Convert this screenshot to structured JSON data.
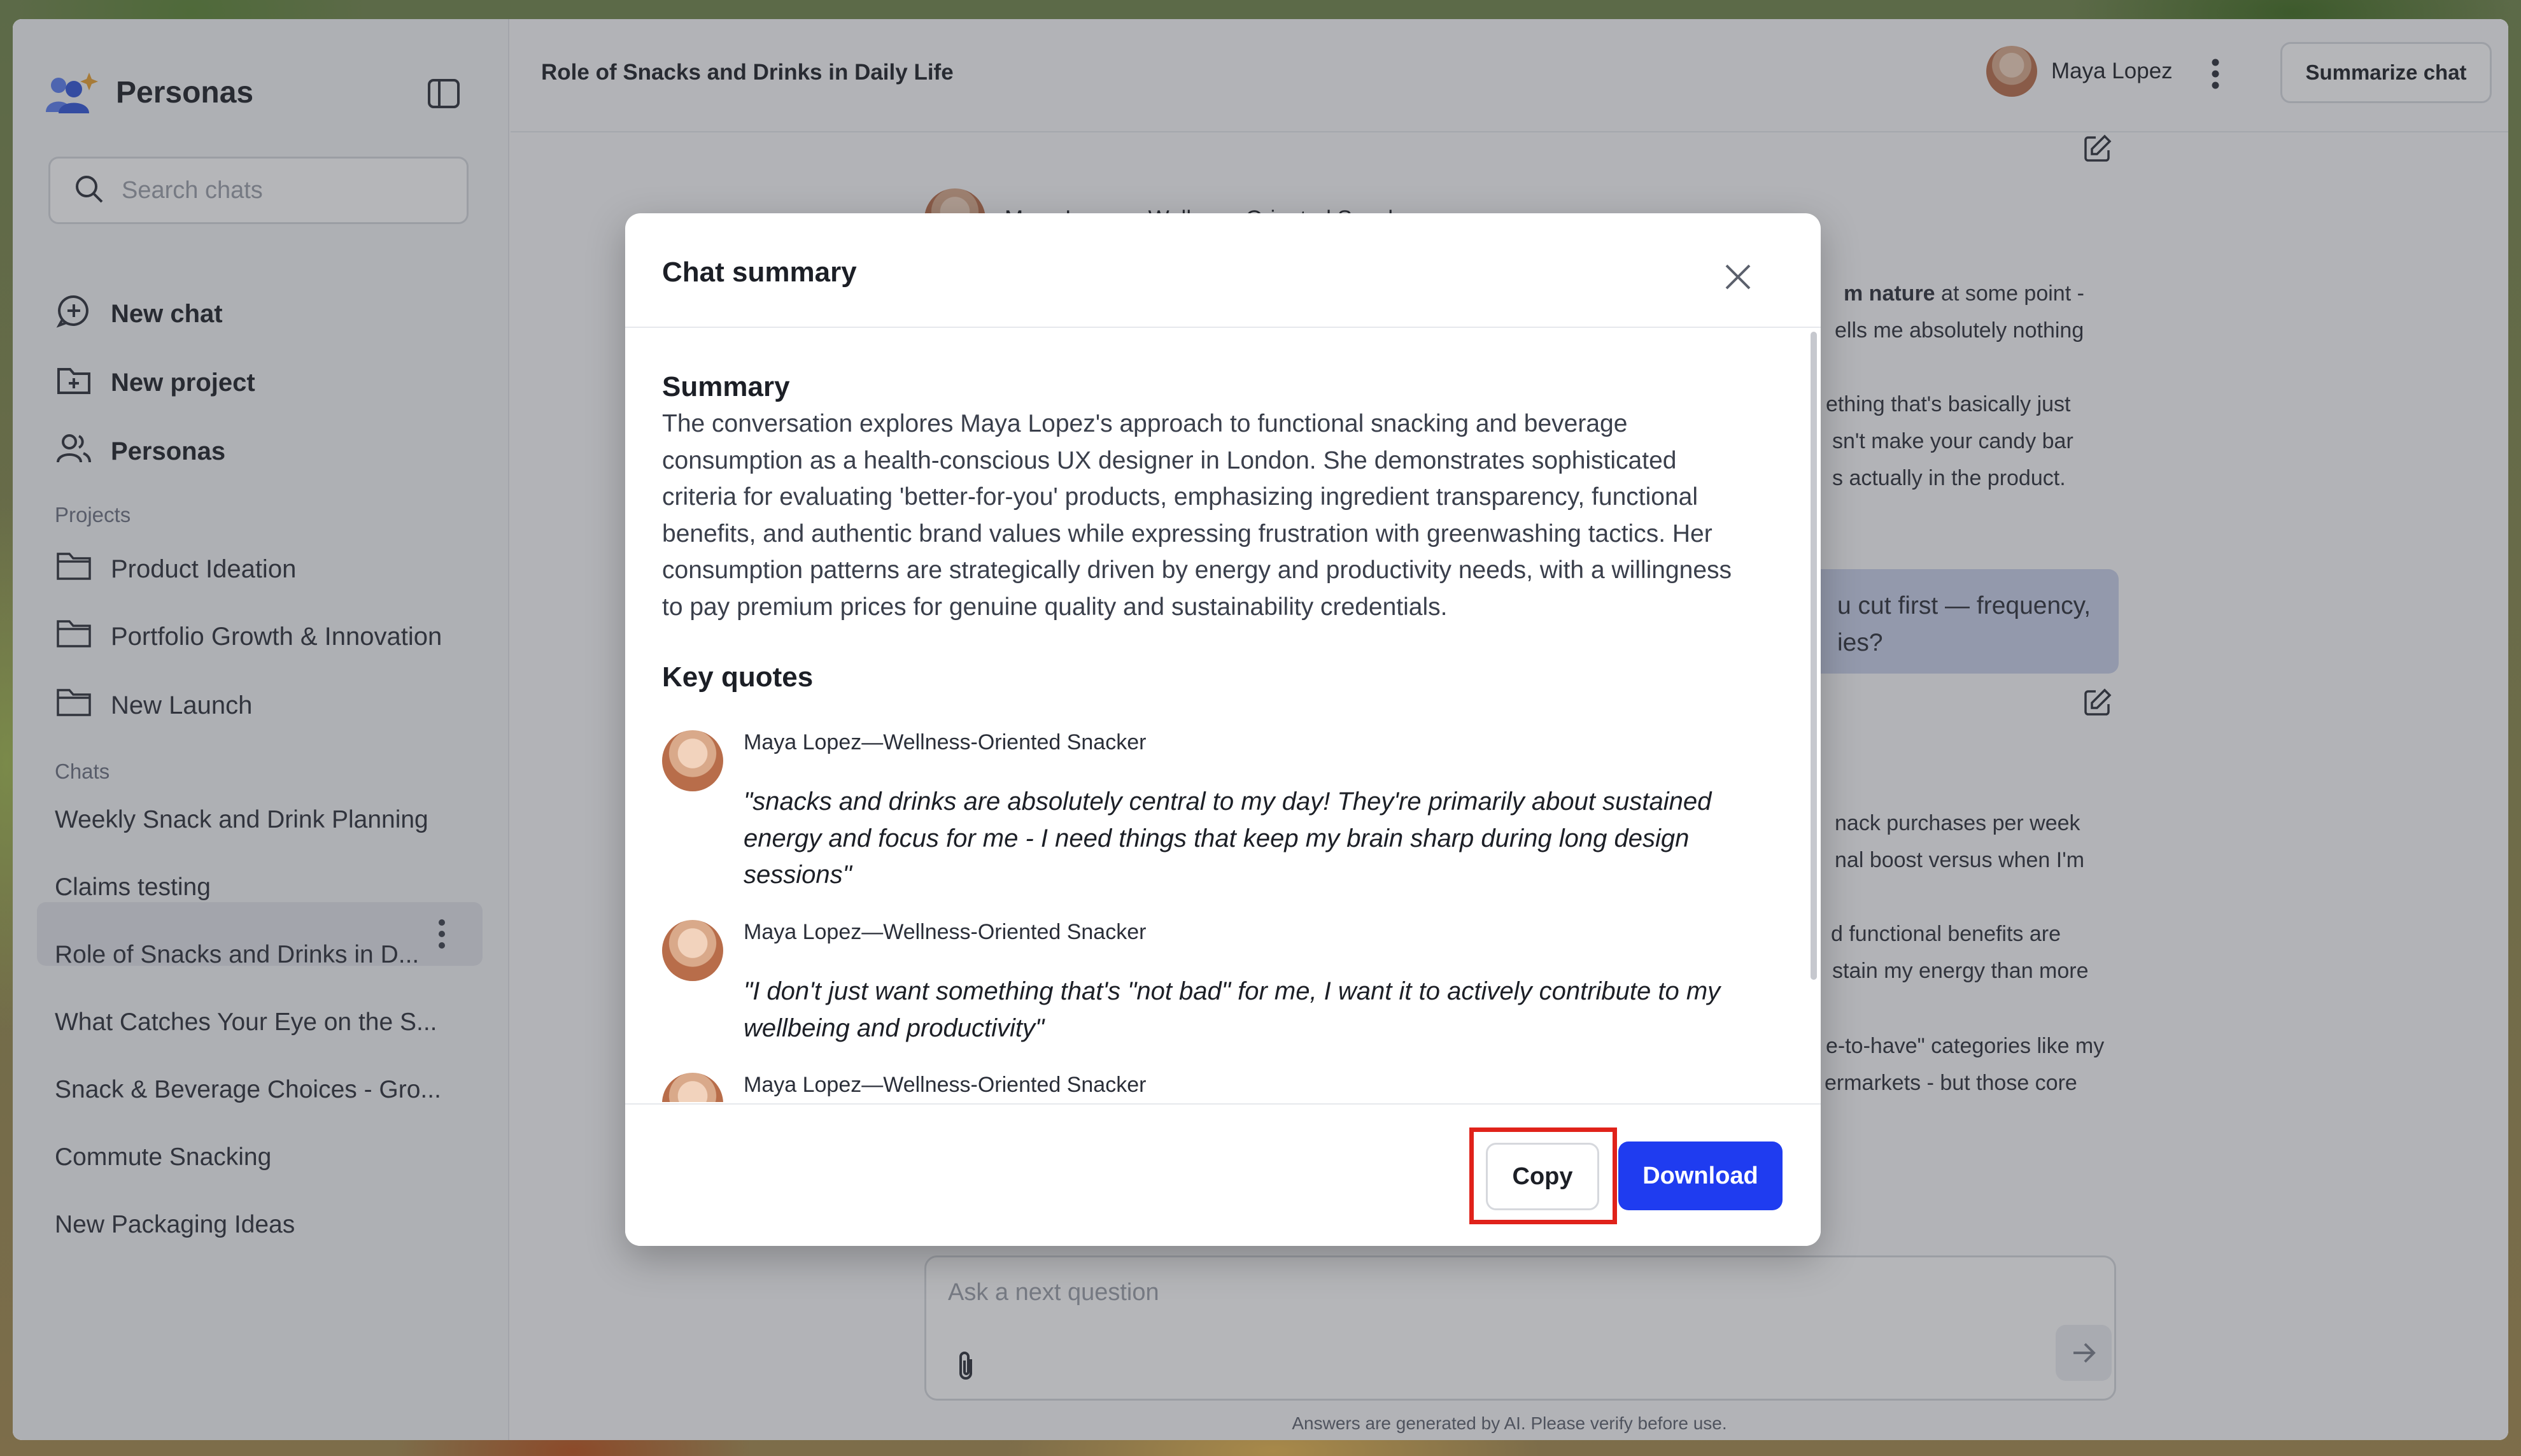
{
  "sidebar": {
    "brand": "Personas",
    "search_placeholder": "Search chats",
    "nav": [
      {
        "label": "New chat",
        "icon": "chat-plus-icon"
      },
      {
        "label": "New project",
        "icon": "folder-plus-icon"
      },
      {
        "label": "Personas",
        "icon": "users-icon"
      }
    ],
    "projects_label": "Projects",
    "projects": [
      "Product Ideation",
      "Portfolio Growth & Innovation",
      "New Launch"
    ],
    "chats_label": "Chats",
    "chats": [
      "Weekly Snack and Drink Planning",
      "Claims testing",
      "Role of Snacks and Drinks in D...",
      "What Catches Your Eye on the S...",
      "Snack & Beverage Choices - Gro...",
      "Commute Snacking",
      "New Packaging Ideas"
    ],
    "active_chat_index": 2
  },
  "header": {
    "title": "Role of Snacks and Drinks in Daily Life",
    "user_name": "Maya Lopez",
    "summarize_label": "Summarize chat"
  },
  "chat": {
    "persona_name": "Maya Lopez—Wellness-Oriented Snacker",
    "visible_fragments": [
      {
        "text": "m nature",
        "bold": true
      },
      {
        "text": " at some point -",
        "bold": false
      },
      {
        "text": "ells me absolutely nothing",
        "bold": false
      },
      {
        "text": "ething that's basically just",
        "bold": false
      },
      {
        "text": "sn't make your candy bar",
        "bold": false
      },
      {
        "text": "s actually in the product.",
        "bold": false
      },
      {
        "text": "u cut first — frequency,",
        "bold": false
      },
      {
        "text": "ies?",
        "bold": false
      },
      {
        "text": "nack purchases per week",
        "bold": false
      },
      {
        "text": "nal boost versus when I'm",
        "bold": false
      },
      {
        "text": "d functional benefits are",
        "bold": false
      },
      {
        "text": "stain my energy than more",
        "bold": false
      },
      {
        "text": "e-to-have\" categories like my",
        "bold": false
      },
      {
        "text": "ermarkets - but those core",
        "bold": false
      }
    ],
    "composer_placeholder": "Ask a next question",
    "disclaimer": "Answers are generated by AI. Please verify before use."
  },
  "modal": {
    "title": "Chat summary",
    "summary_heading": "Summary",
    "summary_text": "The conversation explores Maya Lopez's approach to functional snacking and beverage consumption as a health-conscious UX designer in London. She demonstrates sophisticated criteria for evaluating 'better-for-you' products, emphasizing ingredient transparency, functional benefits, and authentic brand values while expressing frustration with greenwashing tactics. Her consumption patterns are strategically driven by energy and productivity needs, with a willingness to pay premium prices for genuine quality and sustainability credentials.",
    "key_quotes_heading": "Key quotes",
    "quotes": [
      {
        "name": "Maya Lopez—Wellness-Oriented Snacker",
        "text": "\"snacks and drinks are absolutely central to my day! They're primarily about sustained energy and focus for me - I need things that keep my brain sharp during long design sessions\""
      },
      {
        "name": "Maya Lopez—Wellness-Oriented Snacker",
        "text": "\"I don't just want something that's \"not bad\" for me, I want it to actively contribute to my wellbeing and productivity\""
      },
      {
        "name": "Maya Lopez—Wellness-Oriented Snacker",
        "text": ""
      }
    ],
    "copy_label": "Copy",
    "download_label": "Download"
  },
  "colors": {
    "accent": "#1f3cf0",
    "highlight": "#e0221a",
    "user_bubble": "#c8d0ea"
  }
}
